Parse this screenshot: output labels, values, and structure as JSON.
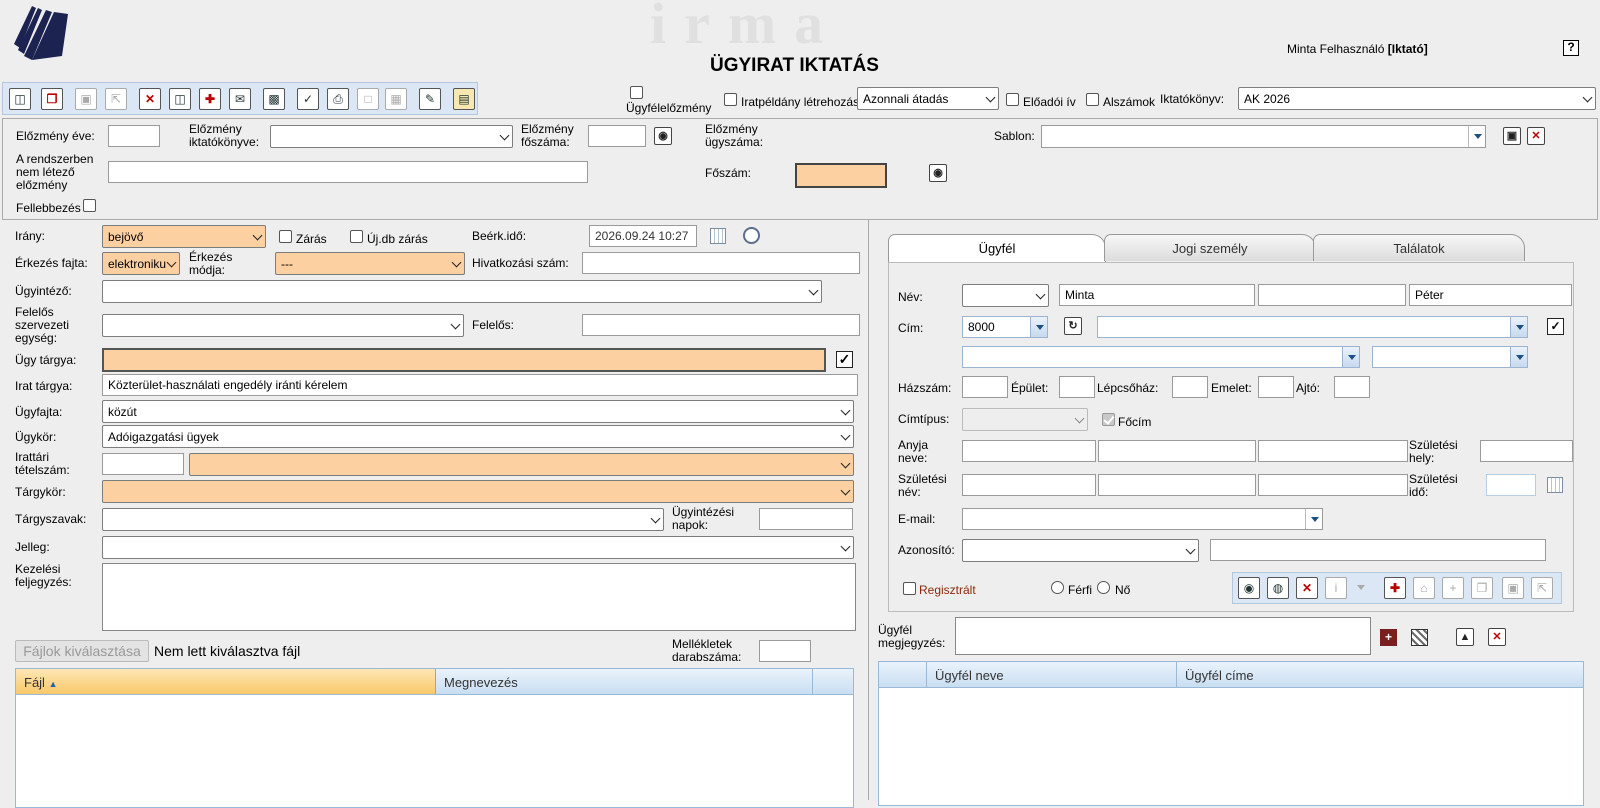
{
  "app": {
    "logo_text": "irma",
    "page_title": "ÜGYIRAT IKTATÁS",
    "user_name": "Minta Felhasználó",
    "user_role": "[Iktató]",
    "help_label": "?"
  },
  "toolbar": {
    "ugyfelelozmeny_label": "Ügyfélelőzmény",
    "iratpeldany_label": "Iratpéldány létrehozás",
    "atadas_value": "Azonnali átadás",
    "eloadoi_iv_label": "Előadói ív",
    "alszamok_label": "Alszámok",
    "iktatokonyv_label": "Iktatókönyv:",
    "iktatokonyv_value": "AK 2026"
  },
  "elozmeny": {
    "eve_label": "Előzmény éve:",
    "iktatokonyve_label": "Előzmény iktatókönyve:",
    "foszama_label": "Előzmény főszáma:",
    "ugyszama_label": "Előzmény ügyszáma:",
    "sablon_label": "Sablon:",
    "nem_letezo_label": "A rendszerben nem létező előzmény",
    "foszam_label": "Főszám:",
    "fellebbezes_label": "Fellebbezés"
  },
  "form": {
    "irany_label": "Irány:",
    "irany_value": "bejövő",
    "zaras_label": "Zárás",
    "uj_db_zaras_label": "Új.db zárás",
    "beerk_ido_label": "Beérk.idő:",
    "beerk_ido_value": "2026.09.24 10:27",
    "erkezes_fajta_label": "Érkezés fajta:",
    "erkezes_fajta_value": "elektroniku",
    "erkezes_modja_label": "Érkezés módja:",
    "erkezes_modja_value": "---",
    "hivatkozasi_szam_label": "Hivatkozási szám:",
    "ugyintezo_label": "Ügyintéző:",
    "felelos_szerv_label": "Felelős szervezeti egység:",
    "felelos_label": "Felelős:",
    "ugy_targya_label": "Ügy tárgya:",
    "irat_targya_label": "Irat tárgya:",
    "irat_targya_value": "Közterület-használati engedély iránti kérelem",
    "ugyfajta_label": "Ügyfajta:",
    "ugyfajta_value": "közút",
    "ugykor_label": "Ügykör:",
    "ugykor_value": "Adóigazgatási ügyek",
    "irattari_label": "Irattári tételszám:",
    "targykor_label": "Tárgykör:",
    "targyszavak_label": "Tárgyszavak:",
    "ugyintezesi_napok_label": "Ügyintézési napok:",
    "jelleg_label": "Jelleg:",
    "kezelesi_label": "Kezelési feljegyzés:",
    "fajlok_button": "Fájlok kiválasztása",
    "nincs_fajl": "Nem lett kiválasztva fájl",
    "mellekletek_label": "Mellékletek darabszáma:",
    "files_columns": [
      "Fájl",
      "Megnevezés"
    ]
  },
  "client": {
    "tabs": [
      "Ügyfél",
      "Jogi személy",
      "Találatok"
    ],
    "nev_label": "Név:",
    "nev_first": "Minta",
    "nev_last": "Péter",
    "cim_label": "Cím:",
    "cim_zip": "8000",
    "hazszam_label": "Házszám:",
    "epulet_label": "Épület:",
    "lepcsohaz_label": "Lépcsőház:",
    "emelet_label": "Emelet:",
    "ajto_label": "Ajtó:",
    "cimtipus_label": "Címtípus:",
    "focim_label": "Főcím",
    "anyja_neve_label": "Anyja neve:",
    "szuletesi_hely_label": "Születési hely:",
    "szuletesi_nev_label": "Születési név:",
    "szuletesi_ido_label": "Születési idő:",
    "email_label": "E-mail:",
    "azonosito_label": "Azonosító:",
    "regisztralt_label": "Regisztrált",
    "ferfi_label": "Férfi",
    "no_label": "Nő",
    "megjegyzes_label": "Ügyfél megjegyzés:",
    "grid_columns": [
      "Ügyfél neve",
      "Ügyfél címe"
    ]
  }
}
